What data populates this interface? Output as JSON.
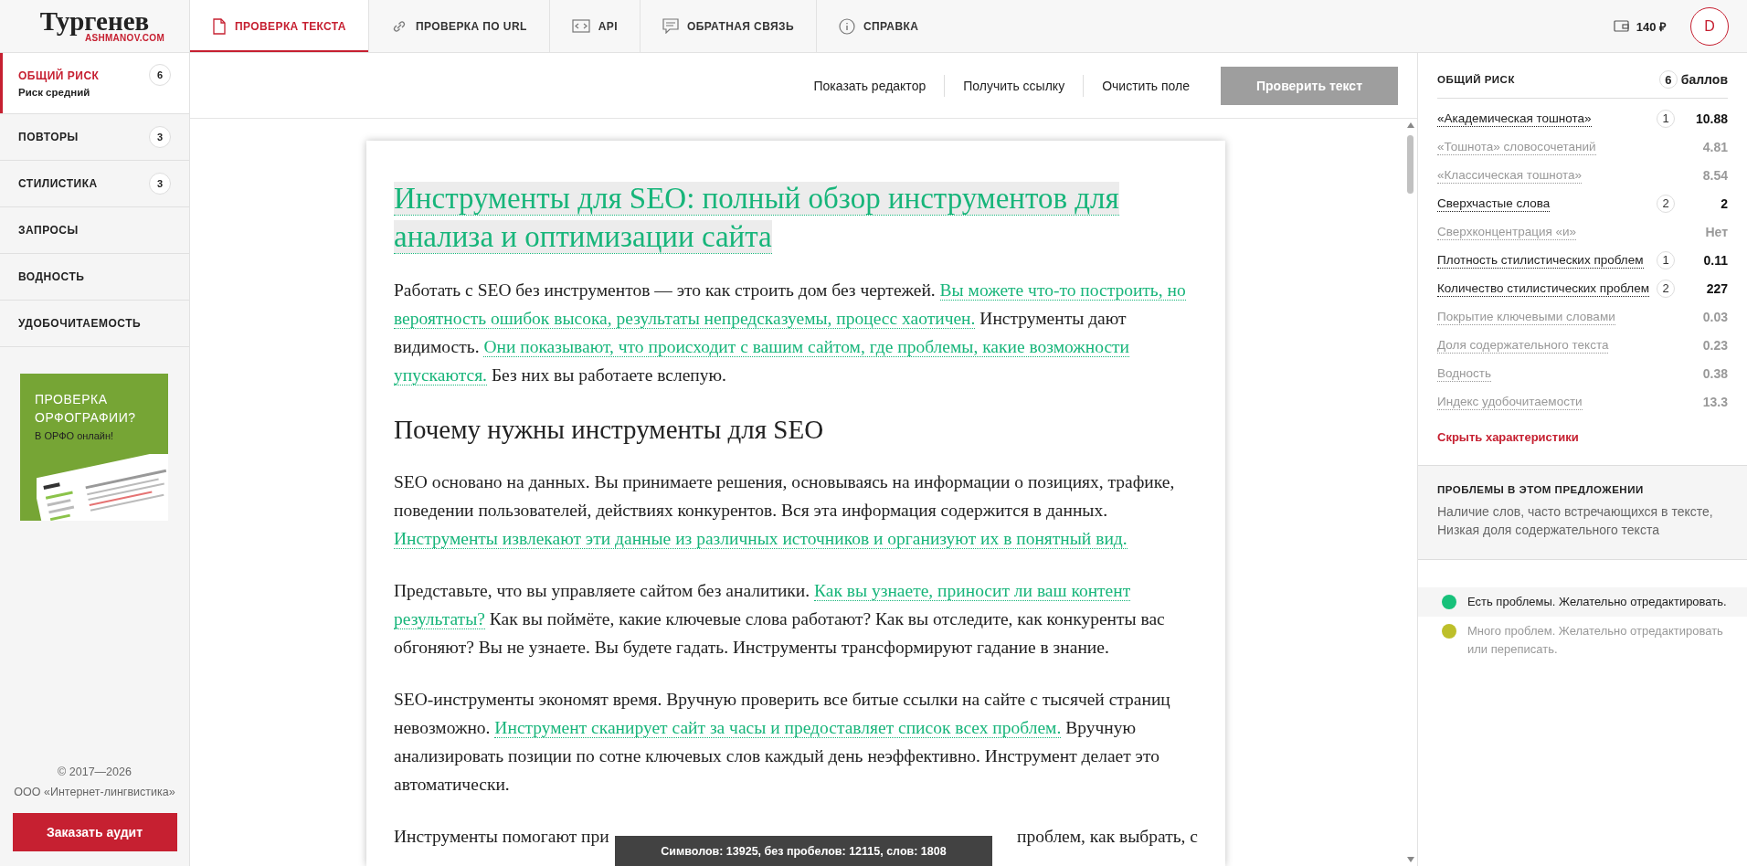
{
  "topbar": {
    "logo": {
      "title": "Тургенев",
      "subtitle": "ASHMANOV.COM"
    },
    "tabs": [
      {
        "label": "ПРОВЕРКА ТЕКСТА",
        "selected": true
      },
      {
        "label": "ПРОВЕРКА ПО URL",
        "selected": false
      },
      {
        "label": "API",
        "selected": false
      },
      {
        "label": "ОБРАТНАЯ СВЯЗЬ",
        "selected": false
      },
      {
        "label": "СПРАВКА",
        "selected": false
      }
    ],
    "balance": "140 ₽",
    "avatar": "D"
  },
  "sidebar": {
    "items": [
      {
        "label": "ОБЩИЙ РИСК",
        "sublabel": "Риск средний",
        "badge": "6",
        "selected": true
      },
      {
        "label": "ПОВТОРЫ",
        "badge": "3",
        "selected": false
      },
      {
        "label": "СТИЛИСТИКА",
        "badge": "3",
        "selected": false
      },
      {
        "label": "ЗАПРОСЫ",
        "selected": false
      },
      {
        "label": "ВОДНОСТЬ",
        "selected": false
      },
      {
        "label": "УДОБОЧИТАЕМОСТЬ",
        "selected": false
      }
    ],
    "banner": {
      "title": "ПРОВЕРКА ОРФОГРАФИИ?",
      "subtitle": "В ОРФО онлайн!"
    },
    "copyright": "© 2017—2026",
    "company": "ООО «Интернет-лингвистика»",
    "order_button": "Заказать аудит"
  },
  "editor": {
    "toolbar": {
      "links": [
        "Показать редактор",
        "Получить ссылку",
        "Очистить поле"
      ],
      "check_button": "Проверить текст"
    },
    "blocks": [
      {
        "kind": "h1",
        "current": true,
        "segments": [
          {
            "text": "Инструменты для SEO: полный обзор инструментов для анализа и оптимизации сайта",
            "highlighted": true
          }
        ]
      },
      {
        "kind": "p",
        "current": false,
        "segments": [
          {
            "text": "Работать с SEO без инструментов — это как строить дом без чертежей. ",
            "highlighted": false
          },
          {
            "text": "Вы можете что-то построить, но вероятность ошибок высока, результаты непредсказуемы, процесс хаотичен.",
            "highlighted": true
          },
          {
            "text": " Инструменты дают видимость. ",
            "highlighted": false
          },
          {
            "text": "Они показывают, что происходит с вашим сайтом, где проблемы, какие возможности упускаются.",
            "highlighted": true
          },
          {
            "text": " Без них вы работаете вслепую.",
            "highlighted": false
          }
        ]
      },
      {
        "kind": "h2",
        "current": false,
        "segments": [
          {
            "text": "Почему нужны инструменты для SEO",
            "highlighted": false
          }
        ]
      },
      {
        "kind": "p",
        "current": false,
        "segments": [
          {
            "text": "SEO основано на данных. Вы принимаете решения, основываясь на информации о позициях, трафике, поведении пользователей, действиях конкурентов. Вся эта информация содержится в данных. ",
            "highlighted": false
          },
          {
            "text": "Инструменты извлекают эти данные из различных источников и организуют их в понятный вид.",
            "highlighted": true
          }
        ]
      },
      {
        "kind": "p",
        "current": false,
        "segments": [
          {
            "text": "Представьте, что вы управляете сайтом без аналитики. ",
            "highlighted": false
          },
          {
            "text": "Как вы узнаете, приносит ли ваш контент результаты?",
            "highlighted": true
          },
          {
            "text": " Как вы поймёте, какие ключевые слова работают? Как вы отследите, как конкуренты вас обгоняют? Вы не узнаете. Вы будете гадать. Инструменты трансформируют гадание в знание.",
            "highlighted": false
          }
        ]
      },
      {
        "kind": "p",
        "current": false,
        "segments": [
          {
            "text": "SEO-инструменты экономят время. Вручную проверить все битые ссылки на сайте с тысячей страниц невозможно. ",
            "highlighted": false
          },
          {
            "text": "Инструмент сканирует сайт за часы и предоставляет список всех проблем.",
            "highlighted": true
          },
          {
            "text": " Вручную анализировать позиции по сотне ключевых слов каждый день неэффективно. Инструмент делает это автоматически.",
            "highlighted": false
          }
        ]
      },
      {
        "kind": "p_split",
        "current": false,
        "segments": [
          {
            "text": "Инструменты помогают при",
            "highlighted": false
          },
          {
            "text": "проблем, как выбрать, с",
            "highlighted": false
          }
        ]
      }
    ],
    "stats": "Символов: 13925, без пробелов: 12115, слов: 1808"
  },
  "metrics": {
    "title": "ОБЩИЙ РИСК",
    "score": "6",
    "score_unit": "баллов",
    "rows": [
      {
        "name": "«Академическая тошнота»",
        "badge": "1",
        "value": "10.88",
        "active": true
      },
      {
        "name": "«Тошнота» словосочетаний",
        "value": "4.81",
        "active": false
      },
      {
        "name": "«Классическая тошнота»",
        "value": "8.54",
        "active": false
      },
      {
        "name": "Сверхчастые слова",
        "badge": "2",
        "value": "2",
        "active": true
      },
      {
        "name": "Сверхконцентрация «и»",
        "value": "Нет",
        "active": false
      },
      {
        "name": "Плотность стилистических проблем",
        "badge": "1",
        "value": "0.11",
        "active": true
      },
      {
        "name": "Количество стилистических проблем",
        "badge": "2",
        "value": "227",
        "active": true
      },
      {
        "name": "Покрытие ключевыми словами",
        "value": "0.03",
        "active": false
      },
      {
        "name": "Доля содержательного текста",
        "value": "0.23",
        "active": false
      },
      {
        "name": "Водность",
        "value": "0.38",
        "active": false
      },
      {
        "name": "Индекс удобочитаемости",
        "value": "13.3",
        "active": false
      }
    ],
    "hide_link": "Скрыть характеристики",
    "problems": {
      "title": "ПРОБЛЕМЫ В ЭТОМ ПРЕДЛОЖЕНИИ",
      "text": "Наличие слов, часто встречающихся в тексте, Низкая доля содержательного текста"
    },
    "legend": [
      {
        "text": "Есть проблемы. Желательно отредактировать.",
        "color": "#17c17a",
        "selected": true
      },
      {
        "text": "Много проблем. Желательно отредактировать или переписать.",
        "color": "#bdbf2a",
        "selected": false
      }
    ]
  }
}
